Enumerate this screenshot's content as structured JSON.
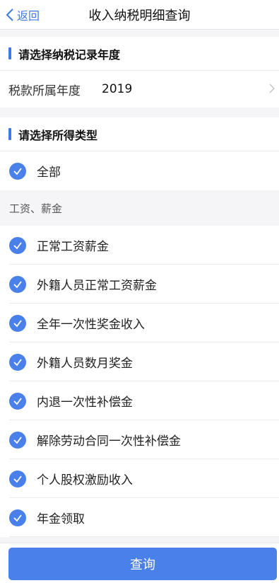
{
  "navbar": {
    "back_label": "返回",
    "title": "收入纳税明细查询"
  },
  "year_section": {
    "heading": "请选择纳税记录年度",
    "label": "税款所属年度",
    "value": "2019"
  },
  "type_section": {
    "heading": "请选择所得类型",
    "all_label": "全部"
  },
  "group": {
    "label": "工资、薪金",
    "items": [
      "正常工资薪金",
      "外籍人员正常工资薪金",
      "全年一次性奖金收入",
      "外籍人员数月奖金",
      "内退一次性补偿金",
      "解除劳动合同一次性补偿金",
      "个人股权激励收入",
      "年金领取"
    ]
  },
  "footer": {
    "query_label": "查询"
  },
  "colors": {
    "accent": "#3f79e6",
    "checkbox": "#4a80ea",
    "button": "#4a80ea"
  }
}
